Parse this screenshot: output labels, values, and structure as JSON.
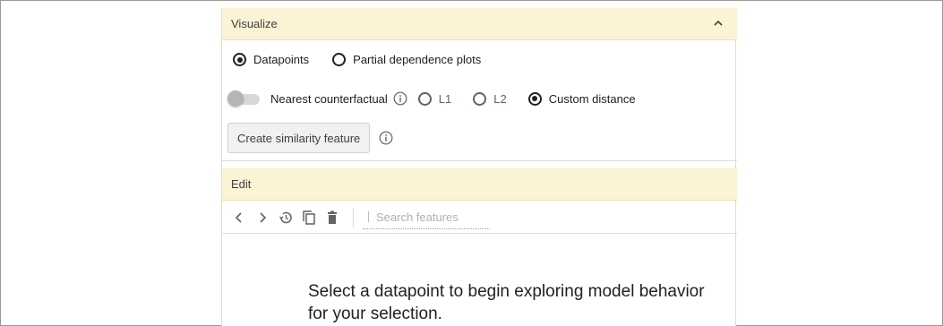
{
  "visualize": {
    "header_label": "Visualize",
    "mode_options": [
      {
        "label": "Datapoints",
        "selected": true
      },
      {
        "label": "Partial dependence plots",
        "selected": false
      }
    ],
    "nearest_counterfactual": {
      "label": "Nearest counterfactual",
      "enabled": false,
      "distance_options": [
        {
          "label": "L1",
          "selected": false
        },
        {
          "label": "L2",
          "selected": false
        },
        {
          "label": "Custom distance",
          "selected": true
        }
      ]
    },
    "create_similarity_button": "Create similarity feature"
  },
  "edit": {
    "header_label": "Edit",
    "toolbar_icons": [
      "chevron-left-icon",
      "chevron-right-icon",
      "history-icon",
      "copy-icon",
      "delete-icon"
    ],
    "search": {
      "placeholder": "Search features",
      "value": ""
    },
    "empty_message": "Select a datapoint to begin exploring model behavior for your selection."
  },
  "colors": {
    "section_header_bg": "#fcf3d4",
    "text": "#202124",
    "muted": "#5f6368"
  }
}
